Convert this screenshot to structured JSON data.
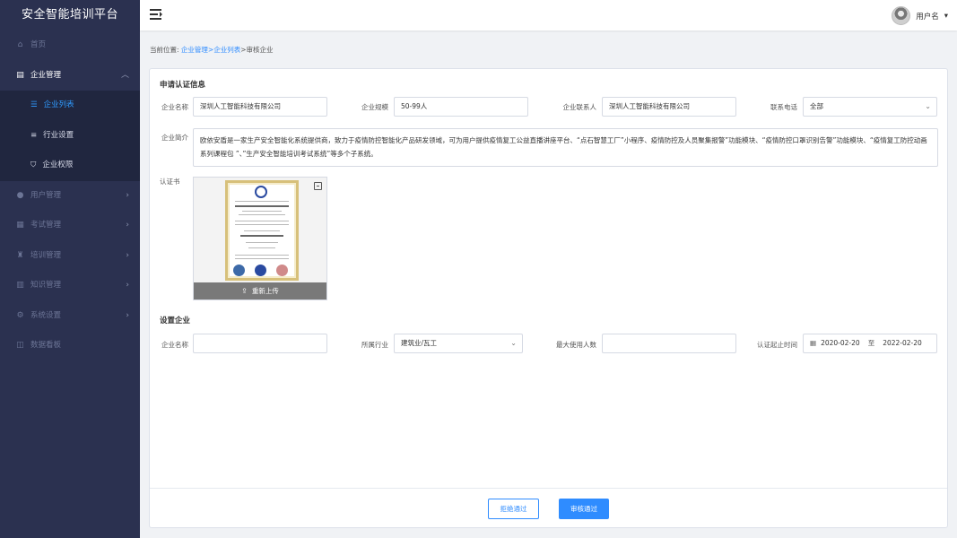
{
  "brand": "安全智能培训平台",
  "menu": [
    {
      "label": "首页",
      "icon": "home-icon"
    },
    {
      "label": "企业管理",
      "icon": "building-icon"
    },
    {
      "label": "用户管理",
      "icon": "user-icon"
    },
    {
      "label": "考试管理",
      "icon": "exam-icon"
    },
    {
      "label": "培训管理",
      "icon": "training-icon"
    },
    {
      "label": "知识管理",
      "icon": "book-icon"
    },
    {
      "label": "系统设置",
      "icon": "gear-icon"
    },
    {
      "label": "数据看板",
      "icon": "dashboard-icon"
    }
  ],
  "submenu": [
    {
      "label": "企业列表",
      "icon": "list-icon",
      "active": true
    },
    {
      "label": "行业设置",
      "icon": "sliders-icon"
    },
    {
      "label": "企业权限",
      "icon": "shield-icon"
    }
  ],
  "header": {
    "username": "用户名"
  },
  "breadcrumb": {
    "prefix": "当前位置:",
    "crumb1": "企业管理",
    "sep1": ">",
    "crumb2": "企业列表",
    "sep2": ">",
    "current": "审核企业"
  },
  "apply": {
    "title": "申请认证信息",
    "name_label": "企业名称",
    "name_value": "深圳人工智能科技有限公司",
    "scale_label": "企业规模",
    "scale_value": "50-99人",
    "contact_label": "企业联系人",
    "contact_value": "深圳人工智能科技有限公司",
    "phone_label": "联系电话",
    "phone_value": "全部",
    "intro_label": "企业简介",
    "intro_value": "欧依安盾是一家生产安全智能化系统提供商，致力于疫情防控智能化产品研发领域，可为用户提供疫情复工公益直播讲座平台、“点石智慧工厂”小程序、疫情防控及人员聚集报警”功能模块、“疫情防控口罩识别告警”功能模块、“疫情复工防控动画系列课程包 ”、”生产安全智能培训考试系统”等多个子系统。",
    "cert_label": "认证书",
    "reupload": "重新上传"
  },
  "setup": {
    "title": "设置企业",
    "name_label": "企业名称",
    "name_value": "",
    "industry_label": "所属行业",
    "industry_value": "建筑业/瓦工",
    "max_users_label": "最大使用人数",
    "max_users_value": "",
    "period_label": "认证起止时间",
    "start_date": "2020-02-20",
    "to": "至",
    "end_date": "2022-02-20"
  },
  "actions": {
    "reject": "拒绝通过",
    "approve": "审核通过"
  },
  "colors": {
    "sidebar": "#2b3150",
    "submenu": "#20263f",
    "accent": "#2f8cff"
  }
}
